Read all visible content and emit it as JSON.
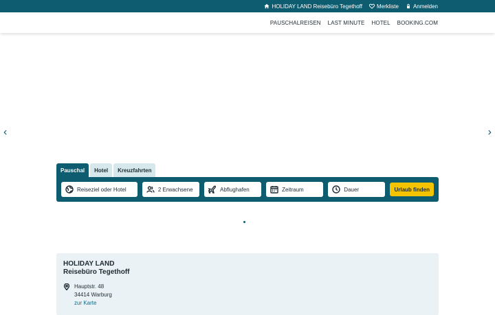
{
  "topbar": {
    "agency_link": "HOLIDAY LAND Reisebüro Tegethoff",
    "wishlist": "Merkliste",
    "login": "Anmelden"
  },
  "nav": [
    "PAUSCHALREISEN",
    "LAST MINUTE",
    "HOTEL",
    "BOOKING.COM"
  ],
  "hero": {
    "prev": "‹",
    "next": "›"
  },
  "search": {
    "tabs": [
      "Pauschal",
      "Hotel",
      "Kreuzfahrten"
    ],
    "active_tab": "Pauschal",
    "destination": "Reiseziel oder Hotel",
    "travellers": "2 Erwachsene",
    "airport": "Abflughafen",
    "period": "Zeitraum",
    "duration": "Dauer",
    "submit": "Urlaub finden"
  },
  "agency": {
    "name_line1": "HOLIDAY LAND",
    "name_line2": "Reisebüro Tegethoff",
    "street": "Hauptstr. 48",
    "city": "34414  Warburg",
    "map_link": "zur Karte"
  },
  "colors": {
    "primary": "#0d5c70",
    "accent": "#f5c400",
    "panel": "#eaf2f5"
  }
}
